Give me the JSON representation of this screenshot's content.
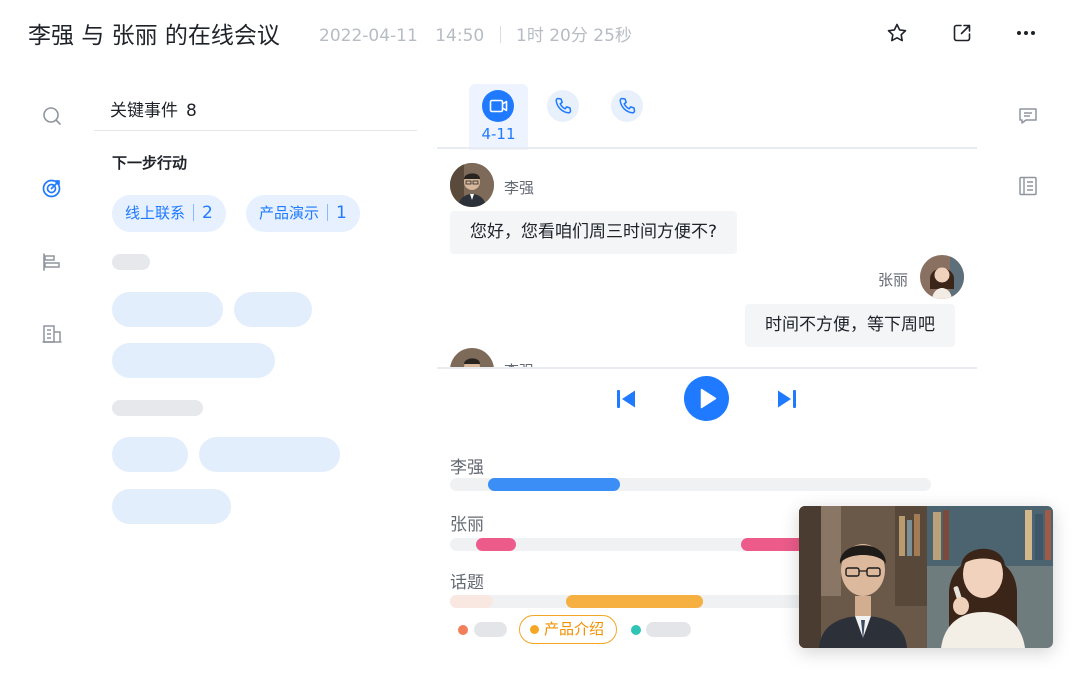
{
  "header": {
    "title": "李强 与  张丽 的在线会议",
    "date": "2022-04-11",
    "time": "14:50",
    "duration": "1时 20分 25秒",
    "icons": [
      "star-icon",
      "share-icon",
      "more-icon"
    ]
  },
  "left_rail": {
    "icons": [
      "search-icon",
      "target-icon",
      "bar-align-icon",
      "building-icon"
    ]
  },
  "key_events": {
    "title": "关键事件",
    "count": "8",
    "subtitle": "下一步行动",
    "chips": [
      {
        "label": "线上联系",
        "count": "2"
      },
      {
        "label": "产品演示",
        "count": "1"
      }
    ]
  },
  "media_tabs": {
    "active_label": "4-11",
    "items": [
      "video-icon",
      "phone-icon",
      "phone-icon"
    ]
  },
  "chat": {
    "messages": [
      {
        "speaker": "李强",
        "text": "您好，您看咱们周三时间方便不?"
      },
      {
        "speaker": "张丽",
        "text": "时间不方便，等下周吧"
      },
      {
        "speaker": "李强",
        "text": ""
      }
    ]
  },
  "player": {
    "controls": [
      "previous-icon",
      "play-icon",
      "next-icon"
    ]
  },
  "tracks": [
    {
      "label": "李强",
      "color": "#3a8ef6"
    },
    {
      "label": "张丽",
      "color": "#ec5b8a"
    },
    {
      "label": "话题",
      "color": "#f5b041"
    }
  ],
  "topics": {
    "legend_colors": [
      "#f27e5a",
      "#f5a623",
      "#2ec4b6"
    ],
    "active_topic": "产品介绍"
  },
  "right_rail": {
    "icons": [
      "comment-icon",
      "notes-icon"
    ]
  },
  "colors": {
    "accent": "#1f7aff",
    "chip_bg": "#e6f0ff",
    "placeholder": "#e3eefd"
  }
}
